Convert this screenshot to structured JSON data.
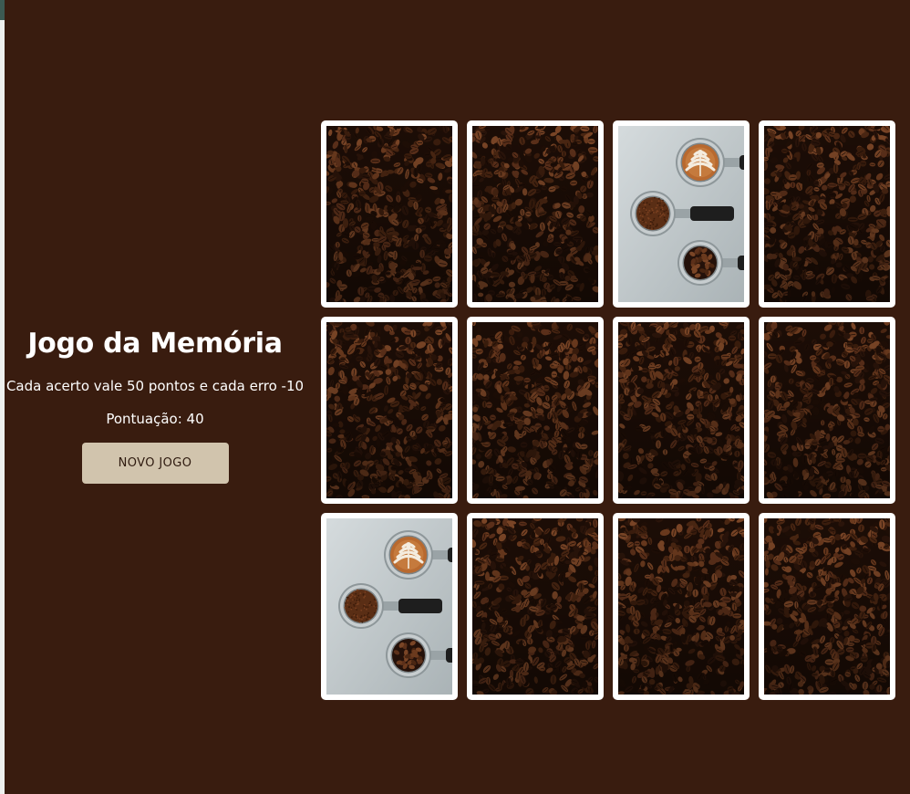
{
  "header": {
    "title": "Jogo da Memória",
    "rules": "Cada acerto vale 50 pontos e cada erro -10",
    "score_label": "Pontuação:",
    "score_value": 40,
    "score_text": "Pontuação: 40"
  },
  "controls": {
    "new_game_label": "NOVO JOGO"
  },
  "board": {
    "rows": 3,
    "columns": 4,
    "cards": [
      {
        "state": "face-down",
        "image": "coffee-beans-back"
      },
      {
        "state": "face-down",
        "image": "coffee-beans-back"
      },
      {
        "state": "face-up",
        "image": "espresso-portafilters"
      },
      {
        "state": "face-down",
        "image": "coffee-beans-back"
      },
      {
        "state": "face-down",
        "image": "coffee-beans-back"
      },
      {
        "state": "face-down",
        "image": "coffee-beans-back"
      },
      {
        "state": "face-down",
        "image": "coffee-beans-back"
      },
      {
        "state": "face-down",
        "image": "coffee-beans-back"
      },
      {
        "state": "face-up",
        "image": "espresso-portafilters"
      },
      {
        "state": "face-down",
        "image": "coffee-beans-back"
      },
      {
        "state": "face-down",
        "image": "coffee-beans-back"
      },
      {
        "state": "face-down",
        "image": "coffee-beans-back"
      }
    ]
  },
  "colors": {
    "background": "#391c0f",
    "button": "#d1c4ad",
    "card_border": "#ffffff",
    "bean_dark": "#2a140a",
    "bean_light": "#6b3a1e",
    "steel": "#c9d1d3"
  }
}
